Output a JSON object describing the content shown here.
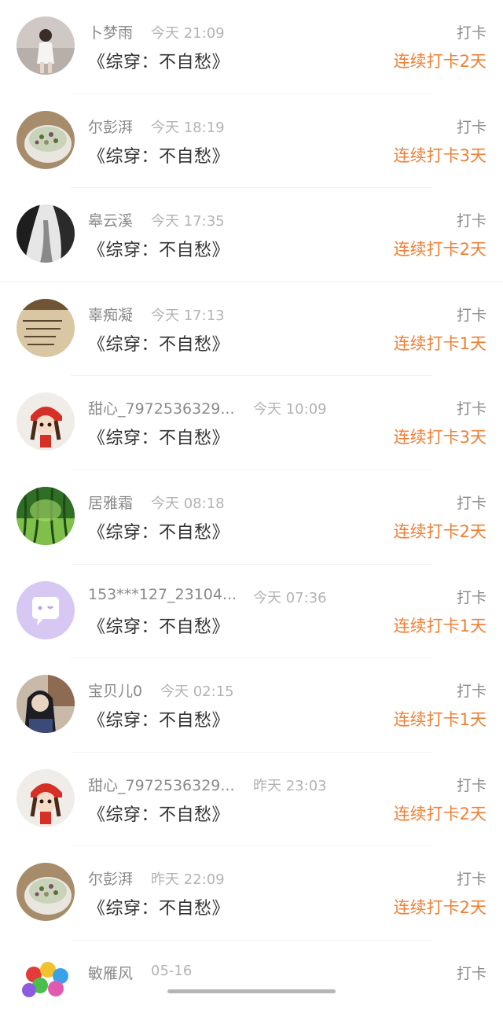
{
  "checkin_label": "打卡",
  "entries": [
    {
      "name": "卜梦雨",
      "time": "今天 21:09",
      "book": "《综穿：不自愁》",
      "streak": "连续打卡2天",
      "avatar": "woman-photo-avatar"
    },
    {
      "name": "尔彭湃",
      "time": "今天 18:19",
      "book": "《综穿：不自愁》",
      "streak": "连续打卡3天",
      "avatar": "food-bowl-avatar"
    },
    {
      "name": "皋云溪",
      "time": "今天 17:35",
      "book": "《综穿：不自愁》",
      "streak": "连续打卡2天",
      "avatar": "ink-landscape-avatar"
    },
    {
      "name": "辜痴凝",
      "time": "今天 17:13",
      "book": "《综穿：不自愁》",
      "streak": "连续打卡1天",
      "avatar": "handwriting-paper-avatar"
    },
    {
      "name": "甜心_7972536329...",
      "time": "今天 10:09",
      "book": "《综穿：不自愁》",
      "streak": "连续打卡3天",
      "avatar": "red-hat-doll-avatar"
    },
    {
      "name": "居雅霜",
      "time": "今天 08:18",
      "book": "《综穿：不自愁》",
      "streak": "连续打卡2天",
      "avatar": "bamboo-forest-avatar"
    },
    {
      "name": "153***127_23104...",
      "time": "今天 07:36",
      "book": "《综穿：不自愁》",
      "streak": "连续打卡1天",
      "avatar": "default-chat-bubble-avatar"
    },
    {
      "name": "宝贝儿0",
      "time": "今天 02:15",
      "book": "《综穿：不自愁》",
      "streak": "连续打卡1天",
      "avatar": "girl-photo-avatar"
    },
    {
      "name": "甜心_7972536329...",
      "time": "昨天 23:03",
      "book": "《综穿：不自愁》",
      "streak": "连续打卡2天",
      "avatar": "red-hat-doll-avatar"
    },
    {
      "name": "尔彭湃",
      "time": "昨天 22:09",
      "book": "《综穿：不自愁》",
      "streak": "连续打卡2天",
      "avatar": "food-bowl-avatar"
    },
    {
      "name": "敏雁风",
      "time": "05-16",
      "book": "",
      "streak": "",
      "avatar": "colorful-balls-avatar"
    }
  ],
  "colors": {
    "streak": "#f07f33",
    "name": "#8a8a8a",
    "time": "#b3b3b3",
    "book": "#333333"
  }
}
